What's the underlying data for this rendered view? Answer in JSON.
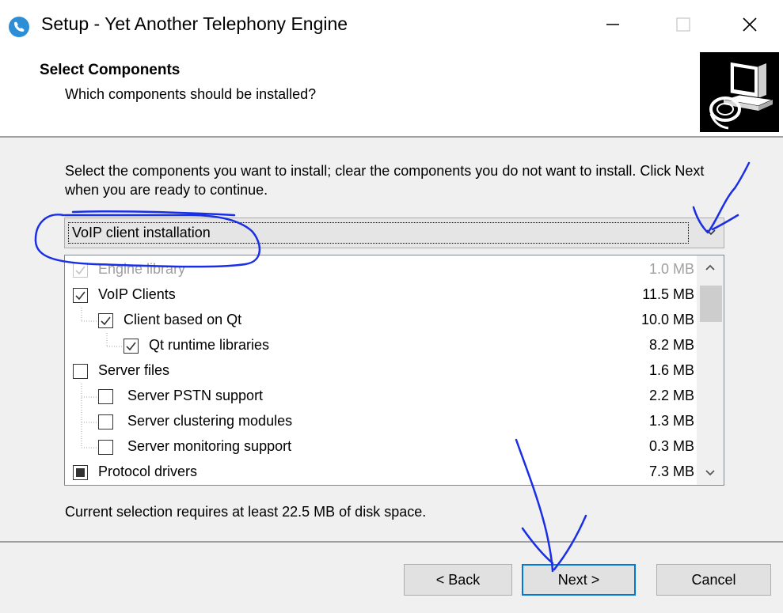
{
  "window": {
    "title": "Setup - Yet Another Telephony Engine",
    "controls": {
      "minimize": "minimize-icon",
      "maximize": "maximize-icon",
      "close": "close-icon"
    }
  },
  "header": {
    "title": "Select Components",
    "subtitle": "Which components should be installed?"
  },
  "body": {
    "intro": "Select the components you want to install; clear the components you do not want to install. Click Next when you are ready to continue.",
    "install_type": "VoIP client installation",
    "components": [
      {
        "label": "Engine library",
        "size": "1.0 MB",
        "state": "checked",
        "disabled": true
      },
      {
        "label": "VoIP Clients",
        "size": "11.5 MB",
        "state": "checked"
      },
      {
        "label": "Client based on Qt",
        "size": "10.0 MB",
        "state": "checked"
      },
      {
        "label": "Qt runtime libraries",
        "size": "8.2 MB",
        "state": "checked"
      },
      {
        "label": "Server files",
        "size": "1.6 MB",
        "state": "unchecked"
      },
      {
        "label": "Server PSTN support",
        "size": "2.2 MB",
        "state": "unchecked"
      },
      {
        "label": "Server clustering modules",
        "size": "1.3 MB",
        "state": "unchecked"
      },
      {
        "label": "Server monitoring support",
        "size": "0.3 MB",
        "state": "unchecked"
      },
      {
        "label": "Protocol drivers",
        "size": "7.3 MB",
        "state": "indeterminate"
      }
    ],
    "disk_requirement": "Current selection requires at least 22.5 MB of disk space."
  },
  "footer": {
    "back_label": "< Back",
    "next_label": "Next >",
    "cancel_label": "Cancel"
  },
  "colors": {
    "accent": "#0078d7",
    "annotation_ink": "#1a2ee6",
    "panel": "#f0f0f0"
  }
}
